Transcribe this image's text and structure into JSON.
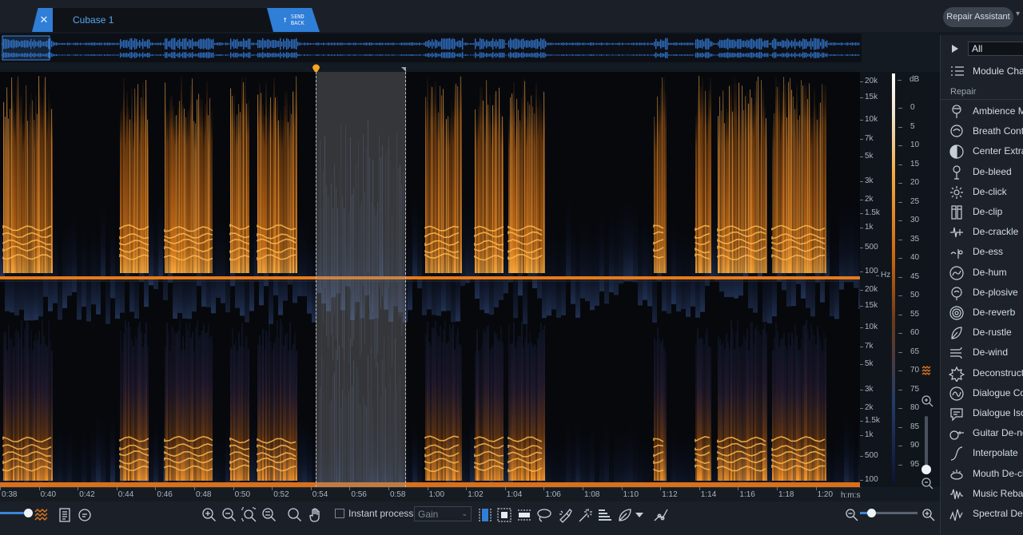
{
  "tab": {
    "close_glyph": "✕",
    "title": "Cubase 1",
    "send_back_line1": "SEND",
    "send_back_line2": "BACK"
  },
  "repair_assistant": {
    "label": "Repair Assistant"
  },
  "frequency_axis": {
    "upper": [
      "20k",
      "15k",
      "10k",
      "7k",
      "5k",
      "3k",
      "2k",
      "1.5k",
      "1k",
      "500",
      "100"
    ],
    "lower": [
      "20k",
      "15k",
      "10k",
      "7k",
      "5k",
      "3k",
      "2k",
      "1.5k",
      "1k",
      "500",
      "100"
    ],
    "unit": "Hz"
  },
  "db_axis": {
    "unit": "dB",
    "ticks": [
      "0",
      "5",
      "10",
      "15",
      "20",
      "25",
      "30",
      "35",
      "40",
      "45",
      "50",
      "55",
      "60",
      "65",
      "70",
      "75",
      "80",
      "85",
      "90",
      "95"
    ]
  },
  "time_axis": {
    "labels": [
      "0:38",
      "0:40",
      "0:42",
      "0:44",
      "0:46",
      "0:48",
      "0:50",
      "0:52",
      "0:54",
      "0:56",
      "0:58",
      "1:00",
      "1:02",
      "1:04",
      "1:06",
      "1:08",
      "1:10",
      "1:12",
      "1:14",
      "1:16",
      "1:18",
      "1:20"
    ],
    "unit": "h:m:s"
  },
  "toolbar": {
    "instant_process_label": "Instant process",
    "gain_mode": "Gain"
  },
  "panel": {
    "filter_value": "All",
    "module_chain_label": "Module Chain",
    "section_label": "Repair",
    "modules": [
      {
        "label": "Ambience Match",
        "icon": "ambience-match-icon"
      },
      {
        "label": "Breath Control",
        "icon": "breath-control-icon"
      },
      {
        "label": "Center Extract",
        "icon": "center-extract-icon"
      },
      {
        "label": "De-bleed",
        "icon": "de-bleed-icon"
      },
      {
        "label": "De-click",
        "icon": "de-click-icon"
      },
      {
        "label": "De-clip",
        "icon": "de-clip-icon"
      },
      {
        "label": "De-crackle",
        "icon": "de-crackle-icon"
      },
      {
        "label": "De-ess",
        "icon": "de-ess-icon"
      },
      {
        "label": "De-hum",
        "icon": "de-hum-icon"
      },
      {
        "label": "De-plosive",
        "icon": "de-plosive-icon"
      },
      {
        "label": "De-reverb",
        "icon": "de-reverb-icon"
      },
      {
        "label": "De-rustle",
        "icon": "de-rustle-icon"
      },
      {
        "label": "De-wind",
        "icon": "de-wind-icon"
      },
      {
        "label": "Deconstruct",
        "icon": "deconstruct-icon"
      },
      {
        "label": "Dialogue Contour",
        "icon": "dialogue-contour-icon"
      },
      {
        "label": "Dialogue Isolate",
        "icon": "dialogue-isolate-icon"
      },
      {
        "label": "Guitar De-noise",
        "icon": "guitar-de-noise-icon"
      },
      {
        "label": "Interpolate",
        "icon": "interpolate-icon"
      },
      {
        "label": "Mouth De-click",
        "icon": "mouth-de-click-icon"
      },
      {
        "label": "Music Rebalance",
        "icon": "music-rebalance-icon"
      },
      {
        "label": "Spectral De-noise",
        "icon": "spectral-de-noise-icon"
      }
    ]
  },
  "colors": {
    "accent": "#2f7ed8",
    "spectrum_hot": "#f28c1e",
    "spectrum_cold": "#2a4a8a",
    "playhead": "#f5a623"
  }
}
